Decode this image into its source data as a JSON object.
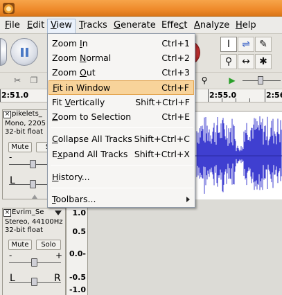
{
  "menubar": {
    "items": [
      {
        "label": "File",
        "mnemonic": "F",
        "rest": "ile"
      },
      {
        "label": "Edit",
        "mnemonic": "E",
        "rest": "dit"
      },
      {
        "label": "View",
        "mnemonic": "V",
        "rest": "iew"
      },
      {
        "label": "Tracks",
        "mnemonic": "T",
        "rest": "racks"
      },
      {
        "label": "Generate",
        "mnemonic": "G",
        "rest": "enerate"
      },
      {
        "label": "Effect",
        "pre": "Effe",
        "mnemonic": "c",
        "rest": "t"
      },
      {
        "label": "Analyze",
        "mnemonic": "A",
        "rest": "nalyze"
      },
      {
        "label": "Help",
        "mnemonic": "H",
        "rest": "elp"
      }
    ]
  },
  "view_menu": {
    "items": [
      {
        "pre": "Zoom ",
        "mn": "I",
        "post": "n",
        "accel": "Ctrl+1"
      },
      {
        "pre": "Zoom ",
        "mn": "N",
        "post": "ormal",
        "accel": "Ctrl+2"
      },
      {
        "pre": "Zoom ",
        "mn": "O",
        "post": "ut",
        "accel": "Ctrl+3"
      },
      {
        "pre": "",
        "mn": "F",
        "post": "it in Window",
        "accel": "Ctrl+F",
        "highlighted": true
      },
      {
        "pre": "Fit ",
        "mn": "V",
        "post": "ertically",
        "accel": "Shift+Ctrl+F"
      },
      {
        "pre": "",
        "mn": "Z",
        "post": "oom to Selection",
        "accel": "Ctrl+E"
      },
      {
        "pre": "",
        "mn": "C",
        "post": "ollapse All Tracks",
        "accel": "Shift+Ctrl+C"
      },
      {
        "pre": "E",
        "mn": "x",
        "post": "pand All Tracks",
        "accel": "Shift+Ctrl+X"
      },
      {
        "pre": "",
        "mn": "H",
        "post": "istory...",
        "accel": ""
      },
      {
        "pre": "",
        "mn": "T",
        "post": "oolbars...",
        "accel": "",
        "submenu": true
      }
    ]
  },
  "ruler": {
    "labels": [
      "2:51.0",
      "2:55.0",
      "2:56"
    ]
  },
  "track1": {
    "name": "pikelets_",
    "info_line1": "Mono, 2205",
    "info_line2": "32-bit float",
    "mute_label": "Mute",
    "solo_label": "So",
    "slider_minus": "-",
    "slider_left": "L"
  },
  "track2": {
    "name": "Evrim_Se",
    "info_line1": "Stereo, 44100Hz",
    "info_line2": "32-bit float",
    "mute_label": "Mute",
    "solo_label": "Solo",
    "slider_minus": "-",
    "slider_plus": "+",
    "slider_left": "L",
    "slider_right": "R",
    "scale": [
      "1.0",
      "0.5",
      "0.0-",
      "-0.5",
      "-1.0"
    ]
  },
  "tools": {
    "icons": [
      "ibeam-icon",
      "envelope-icon",
      "pencil-icon",
      "zoom-icon",
      "timeshift-icon",
      "multi-tool-icon"
    ]
  },
  "colors": {
    "titlebar": "#ee8a2a",
    "waveform": "#3f3fd0",
    "highlight": "#f8d39a"
  }
}
